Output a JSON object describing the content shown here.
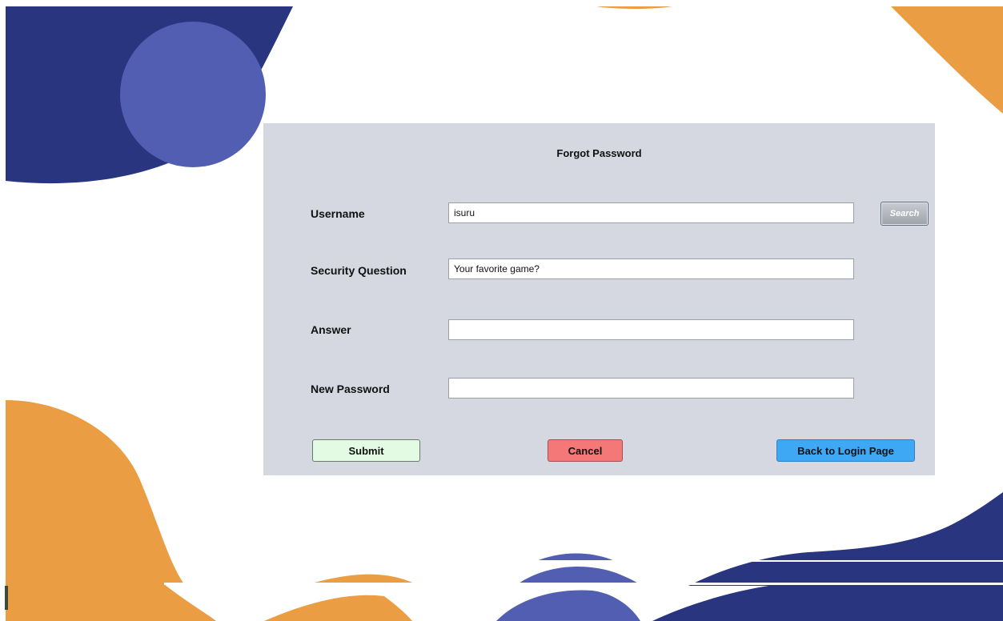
{
  "form": {
    "title": "Forgot Password",
    "username": {
      "label": "Username",
      "value": "isuru",
      "placeholder": ""
    },
    "security_question": {
      "label": "Security Question",
      "value": "Your favorite game?",
      "placeholder": ""
    },
    "answer": {
      "label": "Answer",
      "value": "",
      "placeholder": ""
    },
    "new_password": {
      "label": "New Password",
      "value": "",
      "placeholder": ""
    },
    "buttons": {
      "search": "Search",
      "submit": "Submit",
      "cancel": "Cancel",
      "back": "Back to Login Page"
    }
  },
  "colors": {
    "panel_bg": "#d5d8e0",
    "navy": "#29357f",
    "indigo_circle": "#525eb1",
    "orange": "#eb9d43",
    "submit_bg": "#e2fbe2",
    "cancel_bg": "#f57878",
    "back_bg": "#3ea8f5"
  }
}
